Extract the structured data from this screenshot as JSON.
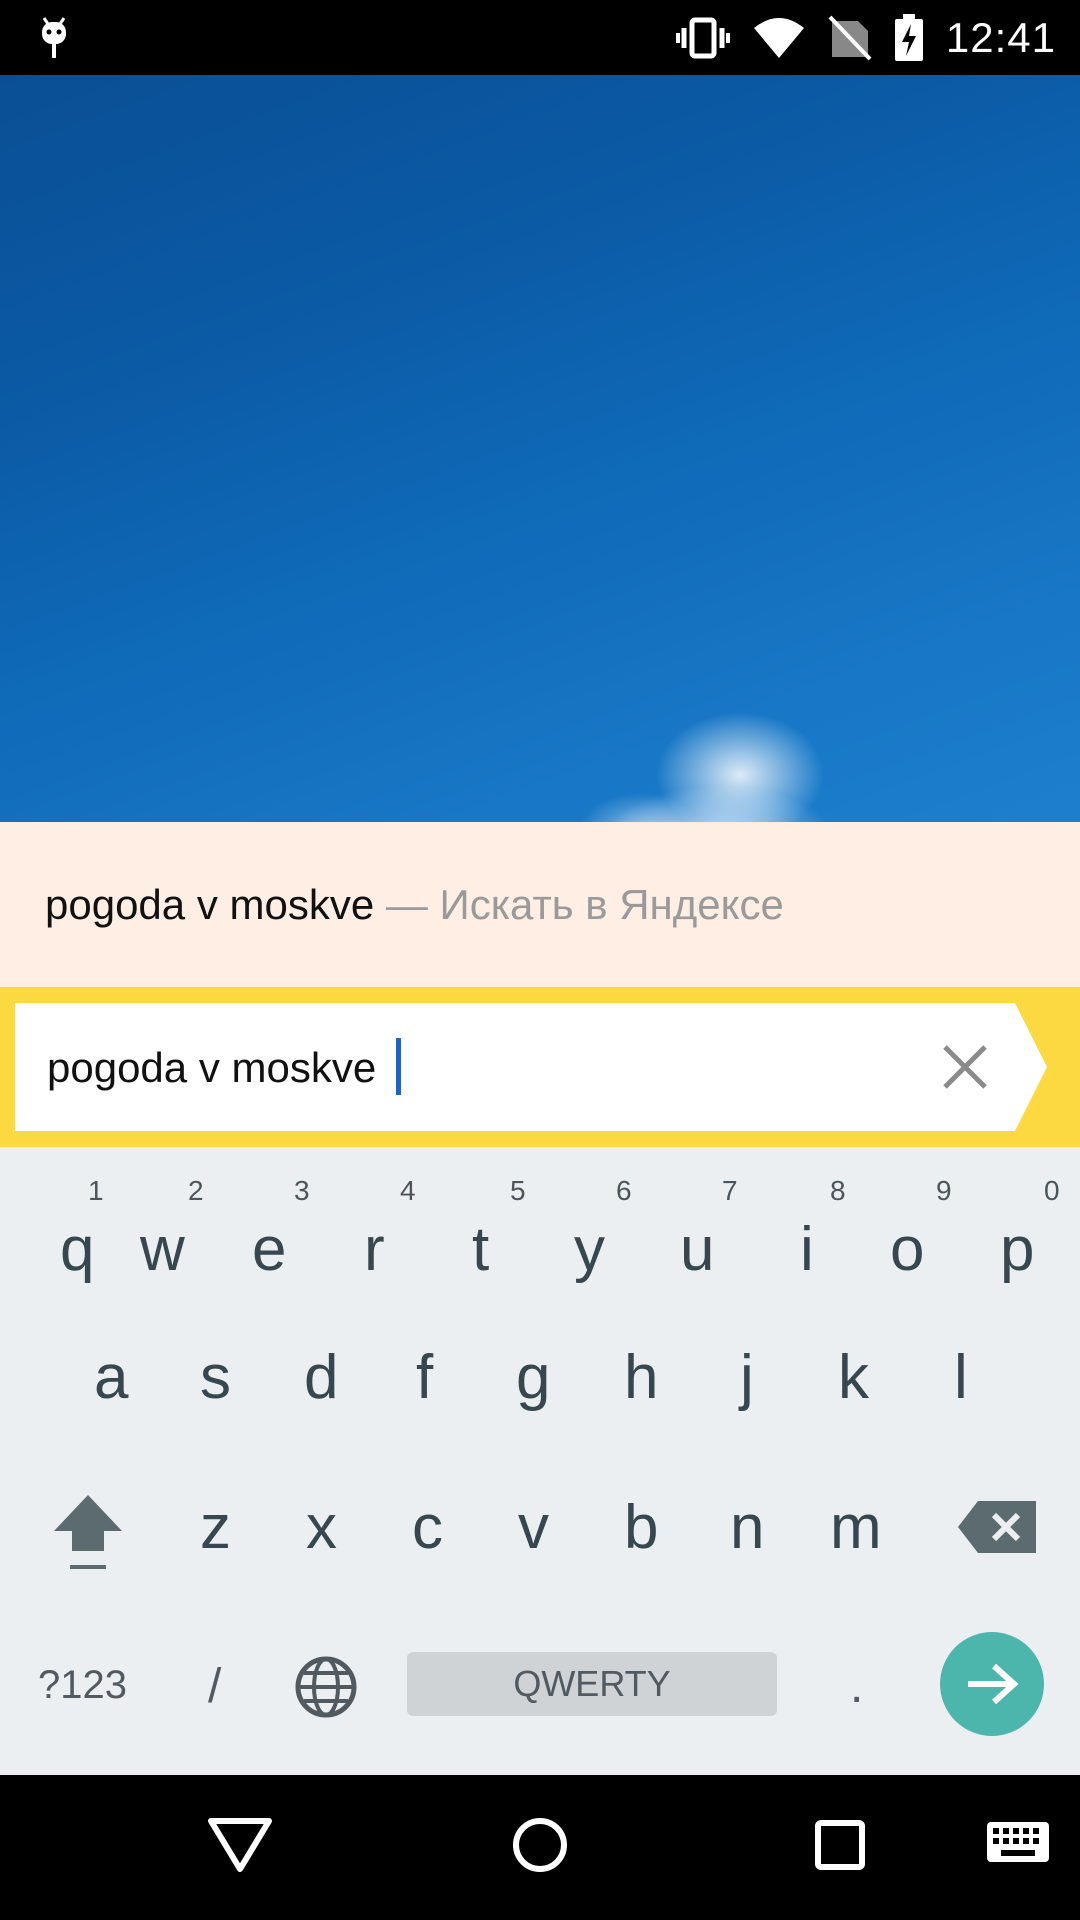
{
  "status_bar": {
    "time": "12:41",
    "icons": [
      "android-debug-icon",
      "vibrate-icon",
      "wifi-icon",
      "no-sim-icon",
      "battery-charging-icon"
    ]
  },
  "suggestion": {
    "query": "pogoda v moskve",
    "hint": " — Искать в Яндексе"
  },
  "search": {
    "value": "pogoda v moskve",
    "clear_icon": "close-icon",
    "accent_color": "#fcd841"
  },
  "keyboard": {
    "row1": [
      {
        "char": "q",
        "hint": "1"
      },
      {
        "char": "w",
        "hint": "2"
      },
      {
        "char": "e",
        "hint": "3"
      },
      {
        "char": "r",
        "hint": "4"
      },
      {
        "char": "t",
        "hint": "5"
      },
      {
        "char": "y",
        "hint": "6"
      },
      {
        "char": "u",
        "hint": "7"
      },
      {
        "char": "i",
        "hint": "8"
      },
      {
        "char": "o",
        "hint": "9"
      },
      {
        "char": "p",
        "hint": "0"
      }
    ],
    "row2": [
      "a",
      "s",
      "d",
      "f",
      "g",
      "h",
      "j",
      "k",
      "l"
    ],
    "row3": [
      "z",
      "x",
      "c",
      "v",
      "b",
      "n",
      "m"
    ],
    "symbols_label": "?123",
    "slash_label": "/",
    "space_label": "QWERTY",
    "period_label": ".",
    "enter_color": "#4db6ac"
  },
  "nav_bar": {
    "icons": [
      "back-icon",
      "home-icon",
      "recents-icon",
      "keyboard-switch-icon"
    ]
  }
}
